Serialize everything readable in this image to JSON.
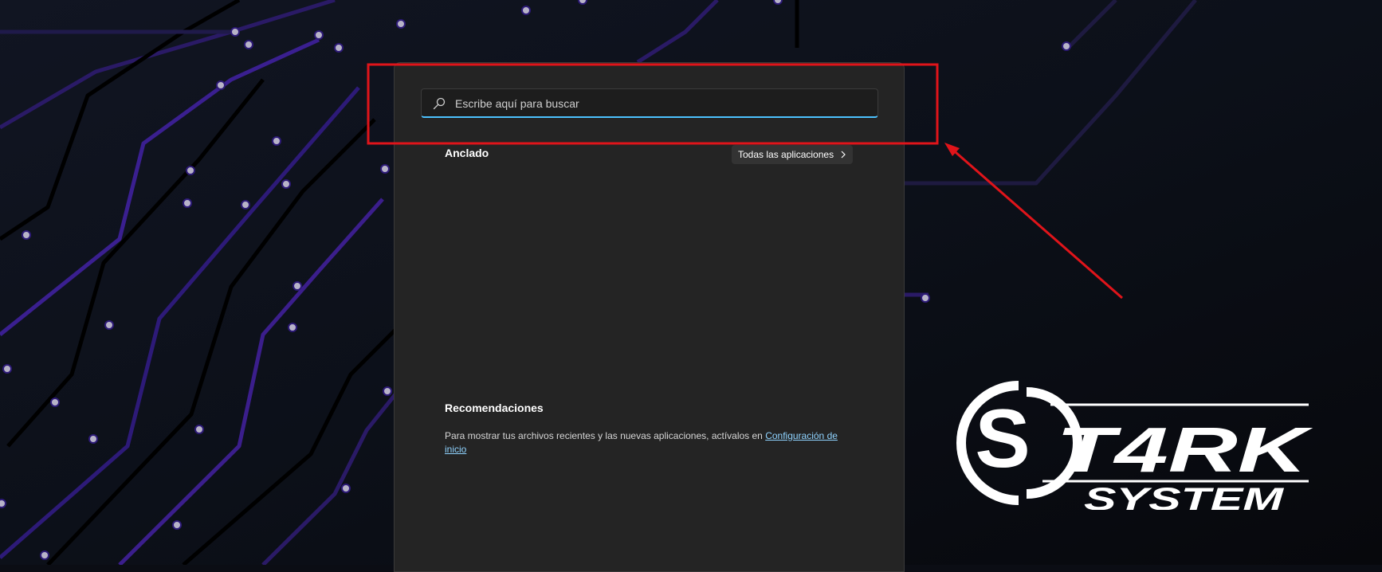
{
  "search": {
    "placeholder": "Escribe aquí para buscar",
    "icon": "search-icon"
  },
  "pinned": {
    "title": "Anclado",
    "all_apps_label": "Todas las aplicaciones",
    "all_apps_icon": "chevron-right-icon"
  },
  "recommendations": {
    "title": "Recomendaciones",
    "text": "Para mostrar tus archivos recientes y las nuevas aplicaciones, actívalos en ",
    "link": "Configuración de inicio"
  },
  "annotation": {
    "highlight_color": "#e0141a"
  },
  "logo": {
    "line1": "T4RK",
    "line2": "SYSTEM",
    "emblem_letter": "S"
  },
  "colors": {
    "accent": "#4cc2ff",
    "wallpaper_circuit": "#3b1e8c",
    "menu_bg": "#242424"
  }
}
